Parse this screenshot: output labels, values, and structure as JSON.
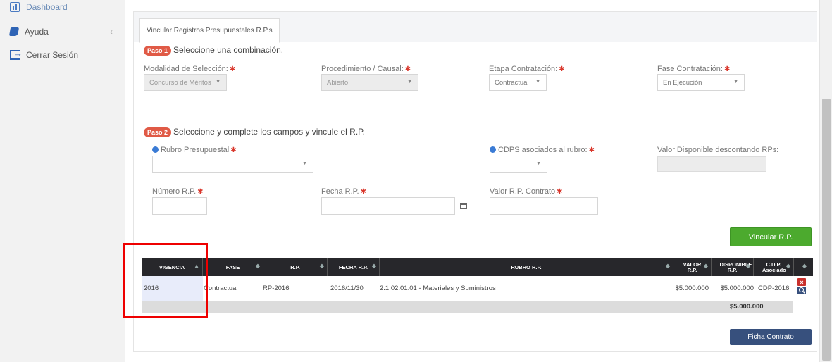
{
  "sidebar": {
    "items": [
      {
        "label": "Dashboard",
        "icon": "dashboard-icon"
      },
      {
        "label": "Ayuda",
        "icon": "book-icon",
        "chevron": "‹"
      },
      {
        "label": "Cerrar Sesión",
        "icon": "sign-out-icon"
      }
    ]
  },
  "tab": {
    "label": "Vincular Registros Presupuestales R.P.s"
  },
  "step1": {
    "badge": "Paso 1",
    "title": "Seleccione una combinación.",
    "fields": [
      {
        "label": "Modalidad de Selección:",
        "value": "Concurso de Méritos"
      },
      {
        "label": "Procedimiento / Causal:",
        "value": "Abierto"
      },
      {
        "label": "Etapa Contratación:",
        "value": "Contractual"
      },
      {
        "label": "Fase Contratación:",
        "value": "En Ejecución"
      }
    ]
  },
  "step2": {
    "badge": "Paso 2",
    "title": "Seleccione y complete los campos y vincule el R.P.",
    "rubro_label": "Rubro Presupuestal",
    "cdps_label": "CDPS asociados al rubro:",
    "valor_disponible_label": "Valor Disponible descontando RPs:",
    "numero_rp_label": "Número R.P.",
    "fecha_rp_label": "Fecha R.P.",
    "valor_rp_label": "Valor R.P. Contrato"
  },
  "buttons": {
    "vincular": "Vincular R.P.",
    "ficha": "Ficha Contrato"
  },
  "table": {
    "headers": {
      "vigencia": "VIGENCIA",
      "fase": "FASE",
      "rp": "R.P.",
      "fecha": "FECHA R.P.",
      "rubro": "RUBRO R.P.",
      "valor": "VALOR R.P.",
      "disponible": "DISPONIBLE R.P.",
      "cdp": "C.D.P. Asociado"
    },
    "row": {
      "vigencia": "2016",
      "fase": "Contractual",
      "rp": "RP-2016",
      "fecha": "2016/11/30",
      "rubro": "2.1.02.01.01 - Materiales y Suministros",
      "valor": "$5.000.000",
      "disponible": "$5.000.000",
      "cdp": "CDP-2016"
    },
    "total": "$5.000.000"
  },
  "colors": {
    "accent_green": "#4caa2e",
    "navy": "#37507d",
    "badge": "#e05a46",
    "highlight": "#ee0000"
  }
}
